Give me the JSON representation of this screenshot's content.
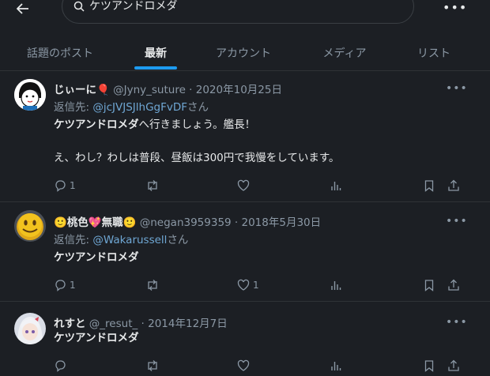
{
  "header": {
    "search_value": "ケツアンドロメダ",
    "back_icon": "arrow-left-icon",
    "search_icon": "search-icon",
    "more_icon": "more-horizontal-icon"
  },
  "tabs": [
    {
      "label": "話題のポスト"
    },
    {
      "label": "最新"
    },
    {
      "label": "アカウント"
    },
    {
      "label": "メディア"
    },
    {
      "label": "リスト"
    }
  ],
  "active_tab": "最新",
  "colors": {
    "accent": "#1d9bf0",
    "link": "#6fa7d4",
    "background": "#1c1f24"
  },
  "tweets": [
    {
      "name": "じぃーに",
      "name_emoji": "🎈",
      "handle": "@Jyny_suture",
      "date": "· 2020年10月25日",
      "reply_prefix": "返信先: ",
      "reply_handle": "@jcJVJSJlhGgFvDF",
      "reply_suffix": "さん",
      "body_bold": "ケツアンドロメダ",
      "body_rest": "へ行きましょう。艦長！",
      "body_line2": "え、わし？わしは普段、昼飯は300円で我慢をしています。",
      "reply_count": "1",
      "like_count": ""
    },
    {
      "name_prefix_emoji": "🙂",
      "name": "桃色",
      "name_mid_emoji": "💖",
      "name2": "無職",
      "name_suffix_emoji": "🙂",
      "handle": "@negan3959359",
      "date": "· 2018年5月30日",
      "reply_prefix": "返信先: ",
      "reply_handle": "@Wakarussell",
      "reply_suffix": "さん",
      "body_bold": "ケツアンドロメダ",
      "reply_count": "1",
      "like_count": "1"
    },
    {
      "name": "れすと",
      "handle": "@_resut_",
      "date": "· 2014年12月7日",
      "body_bold": "ケツアンドロメダ",
      "reply_count": "",
      "like_count": ""
    }
  ]
}
